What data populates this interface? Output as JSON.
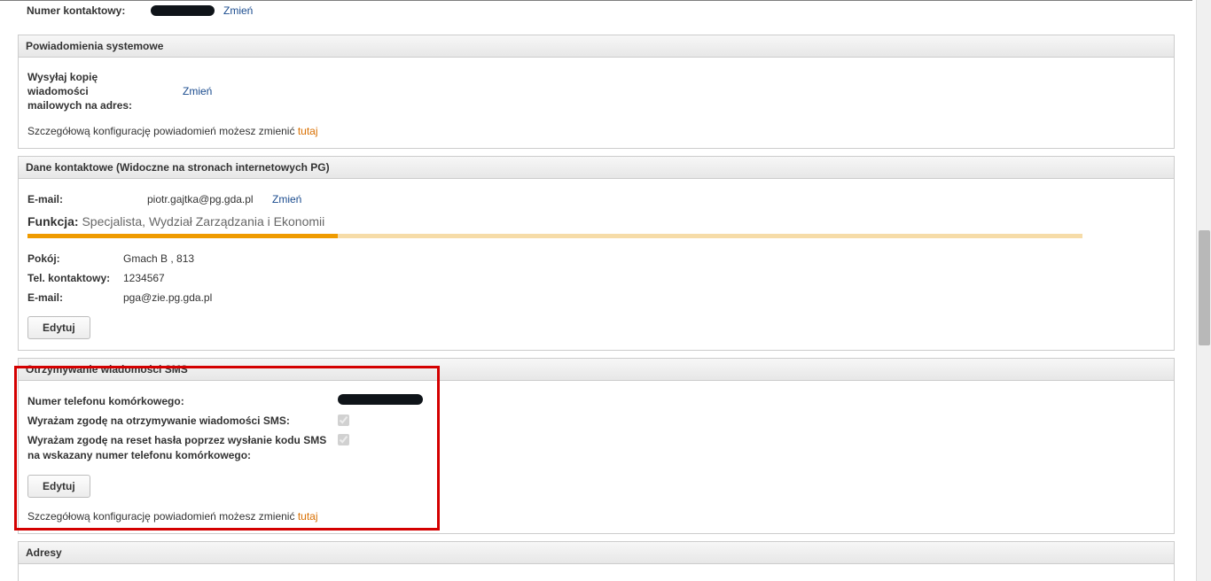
{
  "contact_number": {
    "label": "Numer kontaktowy:",
    "change": "Zmień"
  },
  "notifications": {
    "header": "Powiadomienia systemowe",
    "copy_label_l1": "Wysyłaj kopię",
    "copy_label_l2": "wiadomości",
    "copy_label_l3": "mailowych na adres:",
    "change": "Zmień",
    "hint_prefix": "Szczegółową konfigurację powiadomień możesz zmienić ",
    "hint_link": "tutaj"
  },
  "contact_data": {
    "header": "Dane kontaktowe (Widoczne na stronach internetowych PG)",
    "email_label": "E-mail:",
    "email_value": "piotr.gajtka@pg.gda.pl",
    "change": "Zmień",
    "funkcja_label": "Funkcja:",
    "funkcja_value": "Specjalista, Wydział Zarządzania i Ekonomii",
    "room_label": "Pokój:",
    "room_value": "Gmach B , 813",
    "tel_label": "Tel. kontaktowy:",
    "tel_value": "1234567",
    "email2_label": "E-mail:",
    "email2_value": "pga@zie.pg.gda.pl",
    "edit": "Edytuj"
  },
  "sms": {
    "header": "Otrzymywanie wiadomości SMS",
    "phone_label": "Numer telefonu komórkowego:",
    "agree_sms_label": "Wyrażam zgodę na otrzymywanie wiadomości SMS:",
    "agree_reset_label": "Wyrażam zgodę na reset hasła poprzez wysłanie kodu SMS na wskazany numer telefonu komórkowego:",
    "edit": "Edytuj",
    "hint_prefix": "Szczegółową konfigurację powiadomień możesz zmienić ",
    "hint_link": "tutaj"
  },
  "addresses": {
    "header": "Adresy"
  }
}
